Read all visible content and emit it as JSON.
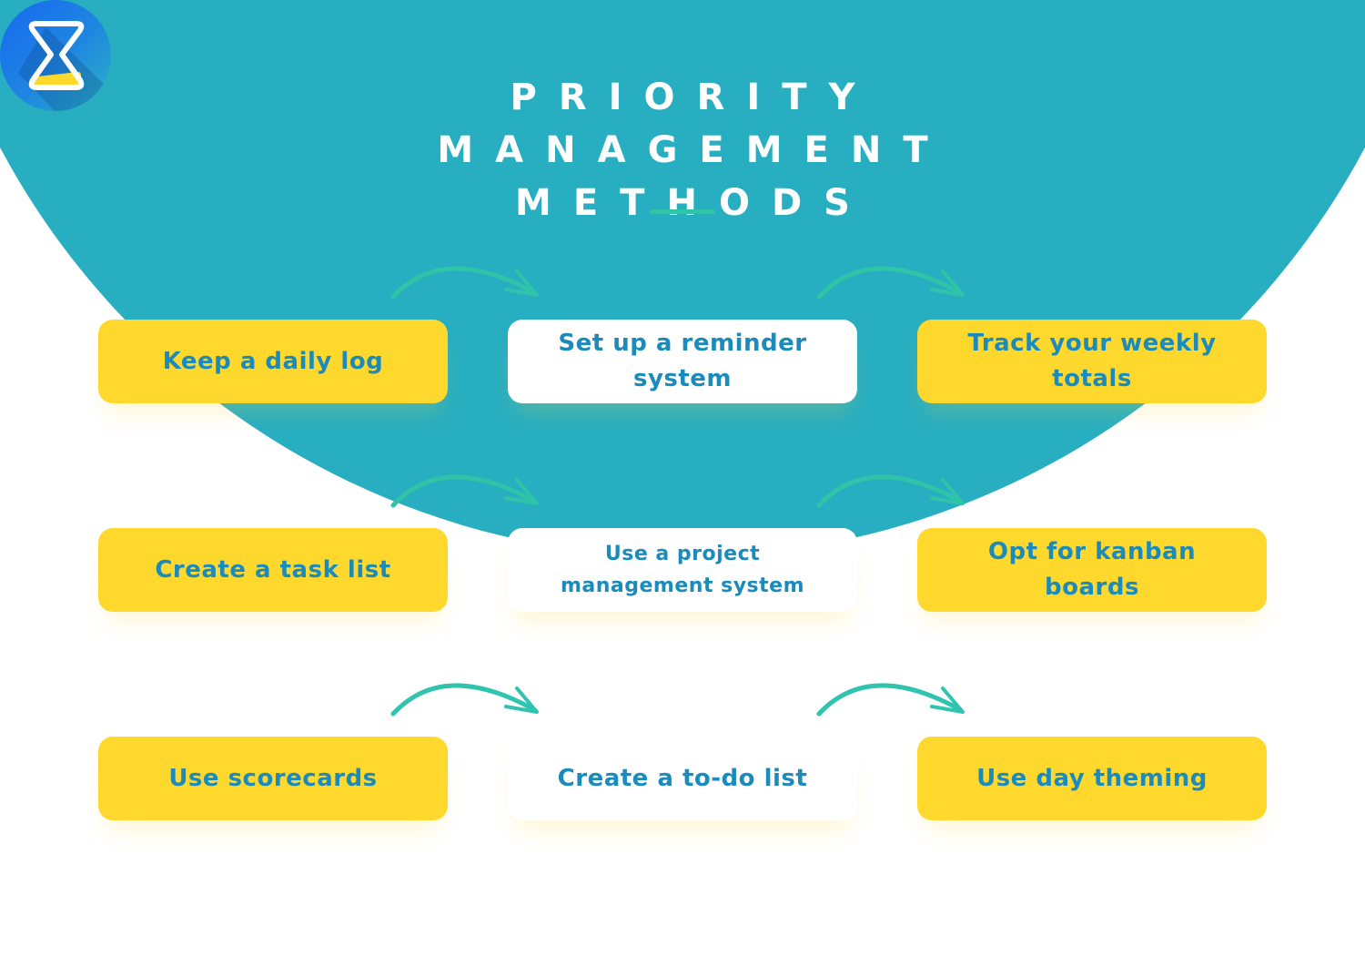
{
  "title": {
    "lines": [
      "PRIORITY",
      "MANAGEMENT",
      "METHODS"
    ]
  },
  "logo": {
    "icon": "hourglass-icon"
  },
  "colors": {
    "background_circle": "#27aec1",
    "card_yellow": "#fed82d",
    "card_white": "#ffffff",
    "card_text": "#1b8bbb",
    "arrow_on_teal": "#2fc3a8",
    "arrow_on_white": "#2fc3b0"
  },
  "methods": [
    {
      "label": "Keep a daily log",
      "style": "yellow"
    },
    {
      "label": "Set up a reminder system",
      "style": "white"
    },
    {
      "label": "Track your weekly totals",
      "style": "yellow"
    },
    {
      "label": "Create a task list",
      "style": "yellow"
    },
    {
      "label": "Use a project management system",
      "style": "white"
    },
    {
      "label": "Opt for kanban boards",
      "style": "yellow"
    },
    {
      "label": "Use scorecards",
      "style": "yellow"
    },
    {
      "label": "Create a to-do list",
      "style": "white"
    },
    {
      "label": "Use day theming",
      "style": "yellow"
    }
  ],
  "arrows": [
    {
      "from": "Keep a daily log",
      "to": "Set up a reminder system"
    },
    {
      "from": "Set up a reminder system",
      "to": "Track your weekly totals"
    },
    {
      "from": "Create a task list",
      "to": "Use a project management system"
    },
    {
      "from": "Use a project management system",
      "to": "Opt for kanban boards"
    },
    {
      "from": "Use scorecards",
      "to": "Create a to-do list"
    },
    {
      "from": "Create a to-do list",
      "to": "Use day theming"
    }
  ]
}
